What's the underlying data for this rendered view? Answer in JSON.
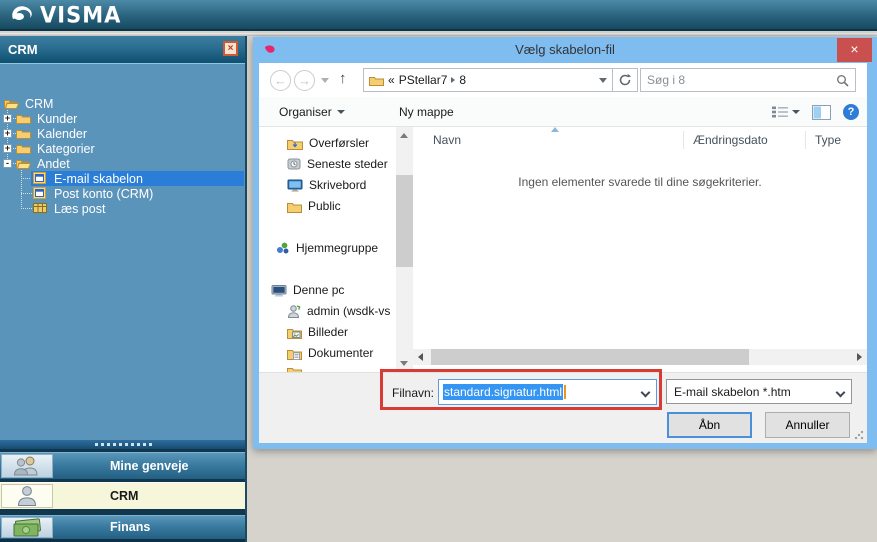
{
  "app": {
    "brand": "VISMA"
  },
  "sidebar": {
    "title": "CRM",
    "close_glyph": "×",
    "tree": [
      {
        "label": "CRM"
      },
      {
        "label": "Kunder",
        "expander": "+"
      },
      {
        "label": "Kalender",
        "expander": "+"
      },
      {
        "label": "Kategorier",
        "expander": "+"
      },
      {
        "label": "Andet",
        "expander": "-"
      },
      {
        "label": "E-mail skabelon",
        "selected": true
      },
      {
        "label": "Post konto (CRM)"
      },
      {
        "label": "Læs post"
      }
    ],
    "modules": [
      {
        "label": "Mine genveje",
        "active": false
      },
      {
        "label": "CRM",
        "active": true
      },
      {
        "label": "Finans",
        "active": false
      }
    ]
  },
  "dialog": {
    "title": "Vælg skabelon-fil",
    "close_glyph": "×",
    "address": {
      "back_glyph": "←",
      "forward_glyph": "→",
      "up_glyph": "↑",
      "root_mark": "«",
      "segments": [
        "PStellar7",
        "8"
      ],
      "search_placeholder": "Søg i 8"
    },
    "toolbar": {
      "organiser": "Organiser",
      "new_folder": "Ny mappe",
      "help_glyph": "?"
    },
    "nav": [
      {
        "label": "Overførsler"
      },
      {
        "label": "Seneste steder"
      },
      {
        "label": "Skrivebord"
      },
      {
        "label": "Public"
      },
      {
        "label": "Hjemmegruppe"
      },
      {
        "label": "Denne pc"
      },
      {
        "label": "admin (wsdk-vs"
      },
      {
        "label": "Billeder"
      },
      {
        "label": "Dokumenter"
      }
    ],
    "columns": [
      "Navn",
      "Ændringsdato",
      "Type"
    ],
    "empty_message": "Ingen elementer svarede til dine søgekriterier.",
    "footer": {
      "filename_label": "Filnavn:",
      "filename_value": "standard.signatur.html",
      "filetype_value": "E-mail skabelon *.htm",
      "open_label": "Åbn",
      "cancel_label": "Annuller"
    }
  },
  "colors": {
    "sidebar_bg": "#5b94bb",
    "selection_blue": "#2b7ed8",
    "dialog_chrome": "#7fbcf0",
    "close_red": "#c9504e",
    "annotation_red": "#d83a34",
    "active_module_bg": "#f6f6da",
    "text_selection": "#3595f2"
  }
}
